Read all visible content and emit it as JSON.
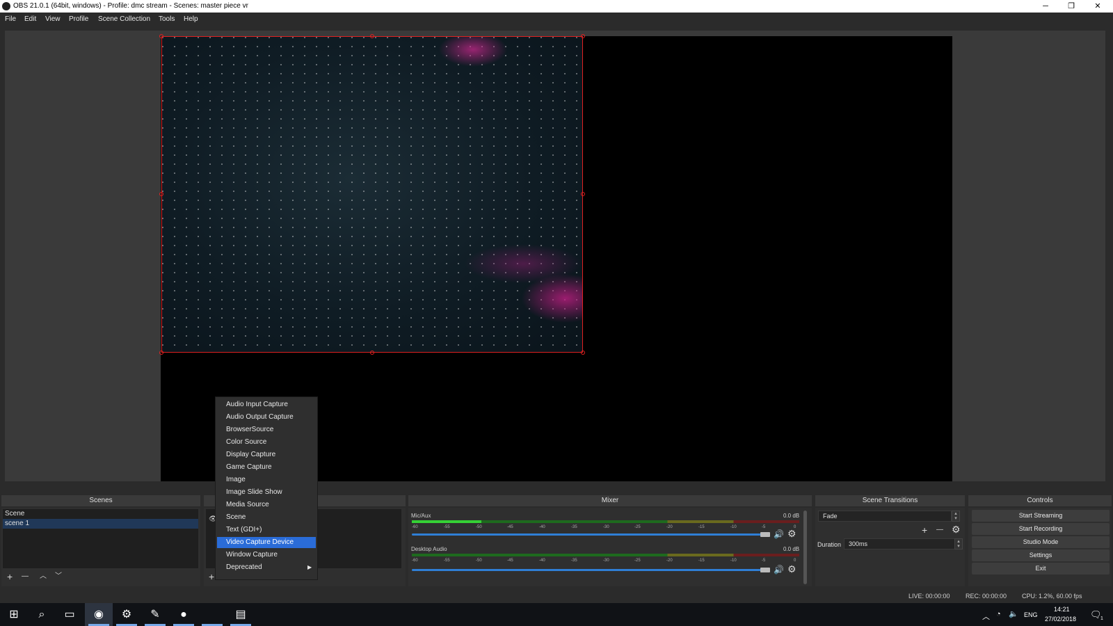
{
  "window": {
    "title": "OBS 21.0.1 (64bit, windows) - Profile: dmc stream - Scenes: master piece vr",
    "minimize": "─",
    "restore": "❐",
    "close": "✕"
  },
  "menu": [
    "File",
    "Edit",
    "View",
    "Profile",
    "Scene Collection",
    "Tools",
    "Help"
  ],
  "scenes": {
    "title": "Scenes",
    "items": [
      {
        "label": "Scene",
        "selected": false
      },
      {
        "label": "scene 1",
        "selected": true
      }
    ],
    "tools": {
      "add": "+",
      "remove": "—",
      "up": "︿",
      "down": "﹀"
    }
  },
  "sources": {
    "add": "+"
  },
  "mixer": {
    "title": "Mixer",
    "channels": [
      {
        "name": "Mic/Aux",
        "db": "0.0 dB",
        "level": 0.18,
        "volume": 1.0
      },
      {
        "name": "Desktop Audio",
        "db": "0.0 dB",
        "level": 0.0,
        "volume": 1.0
      }
    ],
    "ticks": [
      "-60",
      "-55",
      "-50",
      "-45",
      "-40",
      "-35",
      "-30",
      "-25",
      "-20",
      "-15",
      "-10",
      "-5",
      "0"
    ]
  },
  "transitions": {
    "title": "Scene Transitions",
    "selected": "Fade",
    "add": "+",
    "remove": "—",
    "duration_label": "Duration",
    "duration_value": "300ms"
  },
  "controls": {
    "title": "Controls",
    "buttons": [
      "Start Streaming",
      "Start Recording",
      "Studio Mode",
      "Settings",
      "Exit"
    ]
  },
  "context_menu": {
    "items": [
      {
        "label": "Audio Input Capture",
        "highlighted": false
      },
      {
        "label": "Audio Output Capture",
        "highlighted": false
      },
      {
        "label": "BrowserSource",
        "highlighted": false
      },
      {
        "label": "Color Source",
        "highlighted": false
      },
      {
        "label": "Display Capture",
        "highlighted": false
      },
      {
        "label": "Game Capture",
        "highlighted": false
      },
      {
        "label": "Image",
        "highlighted": false
      },
      {
        "label": "Image Slide Show",
        "highlighted": false
      },
      {
        "label": "Media Source",
        "highlighted": false
      },
      {
        "label": "Scene",
        "highlighted": false
      },
      {
        "label": "Text (GDI+)",
        "highlighted": false
      },
      {
        "label": "Video Capture Device",
        "highlighted": true
      },
      {
        "label": "Window Capture",
        "highlighted": false
      },
      {
        "label": "Deprecated",
        "highlighted": false,
        "submenu": true
      }
    ]
  },
  "status": {
    "live": "LIVE: 00:00:00",
    "rec": "REC: 00:00:00",
    "cpu": "CPU: 1.2%, 60.00 fps"
  },
  "taskbar": {
    "tray": {
      "lang": "ENG",
      "time": "14:21",
      "date": "27/02/2018",
      "notifications": "1"
    }
  },
  "colors": {
    "accent": "#2a6cd8",
    "selection_border": "#e02020",
    "background": "#2b2b2b"
  }
}
